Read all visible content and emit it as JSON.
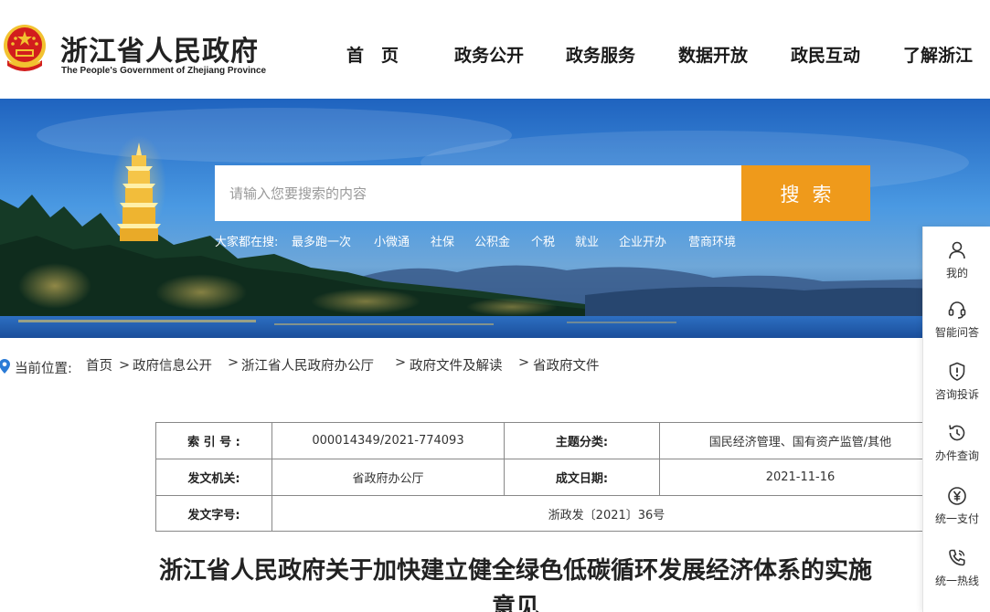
{
  "header": {
    "site_name": "浙江省人民政府",
    "site_name_en": "The People's Government of Zhejiang Province",
    "nav": [
      "首　页",
      "政务公开",
      "政务服务",
      "数据开放",
      "政民互动",
      "了解浙江"
    ]
  },
  "search": {
    "placeholder": "请输入您要搜索的内容",
    "button": "搜索",
    "hot_label": "大家都在搜:",
    "hot_items": [
      "最多跑一次",
      "小微通",
      "社保",
      "公积金",
      "个税",
      "就业",
      "企业开办",
      "营商环境"
    ]
  },
  "breadcrumb": {
    "label": "当前位置:",
    "items": [
      "首页",
      "政府信息公开",
      "浙江省人民政府办公厅",
      "政府文件及解读",
      "省政府文件"
    ],
    "separator": ">"
  },
  "meta": {
    "index_key": "索 引 号 :",
    "index_value": "000014349/2021-774093",
    "topic_key": "主题分类:",
    "topic_value": "国民经济管理、国有资产监管/其他",
    "issuer_key": "发文机关:",
    "issuer_value": "省政府办公厅",
    "date_key": "成文日期:",
    "date_value": "2021-11-16",
    "docno_key": "发文字号:",
    "docno_value": "浙政发〔2021〕36号"
  },
  "article": {
    "title_line1": "浙江省人民政府关于加快建立健全绿色低碳循环发展经济体系的实施",
    "title_line2": "意见"
  },
  "sidebar": {
    "items": [
      {
        "label": "我的",
        "icon": "user-icon"
      },
      {
        "label": "智能问答",
        "icon": "headset-icon"
      },
      {
        "label": "咨询投诉",
        "icon": "shield-alert-icon"
      },
      {
        "label": "办件查询",
        "icon": "history-icon"
      },
      {
        "label": "统一支付",
        "icon": "yuan-icon"
      },
      {
        "label": "统一热线",
        "icon": "phone-icon"
      }
    ]
  },
  "colors": {
    "accent": "#ef9a1b",
    "emblem_red": "#d21d1d",
    "emblem_gold": "#f2c230"
  }
}
